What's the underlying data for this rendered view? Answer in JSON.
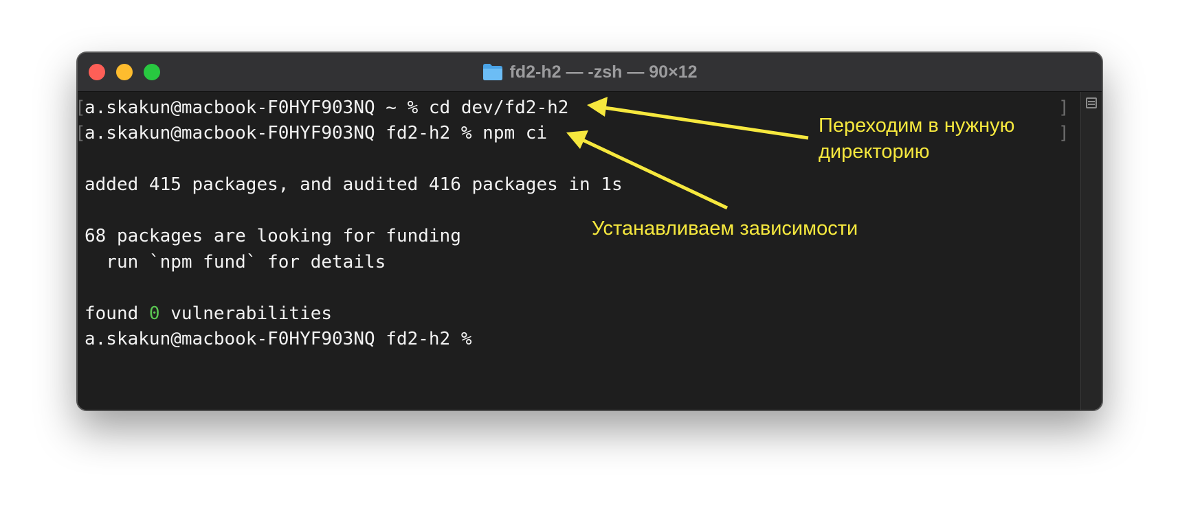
{
  "window": {
    "title": "fd2-h2 — -zsh — 90×12"
  },
  "terminal": {
    "lines": [
      "a.skakun@macbook-F0HYF903NQ ~ % cd dev/fd2-h2",
      "a.skakun@macbook-F0HYF903NQ fd2-h2 % npm ci",
      "",
      "added 415 packages, and audited 416 packages in 1s",
      "",
      "68 packages are looking for funding",
      "  run `npm fund` for details",
      "",
      "found ",
      "a.skakun@macbook-F0HYF903NQ fd2-h2 %"
    ],
    "vuln_count": "0",
    "vuln_suffix": " vulnerabilities"
  },
  "annotations": {
    "cd_note": "Переходим в нужную\nдиректорию",
    "install_note": "Устанавливаем зависимости"
  },
  "colors": {
    "annotation": "#f6e83e",
    "zero_highlight": "#5ac752",
    "terminal_bg": "#1e1e1e"
  },
  "icons": {
    "title": "folder-icon",
    "scroll": "split-pane-icon"
  }
}
